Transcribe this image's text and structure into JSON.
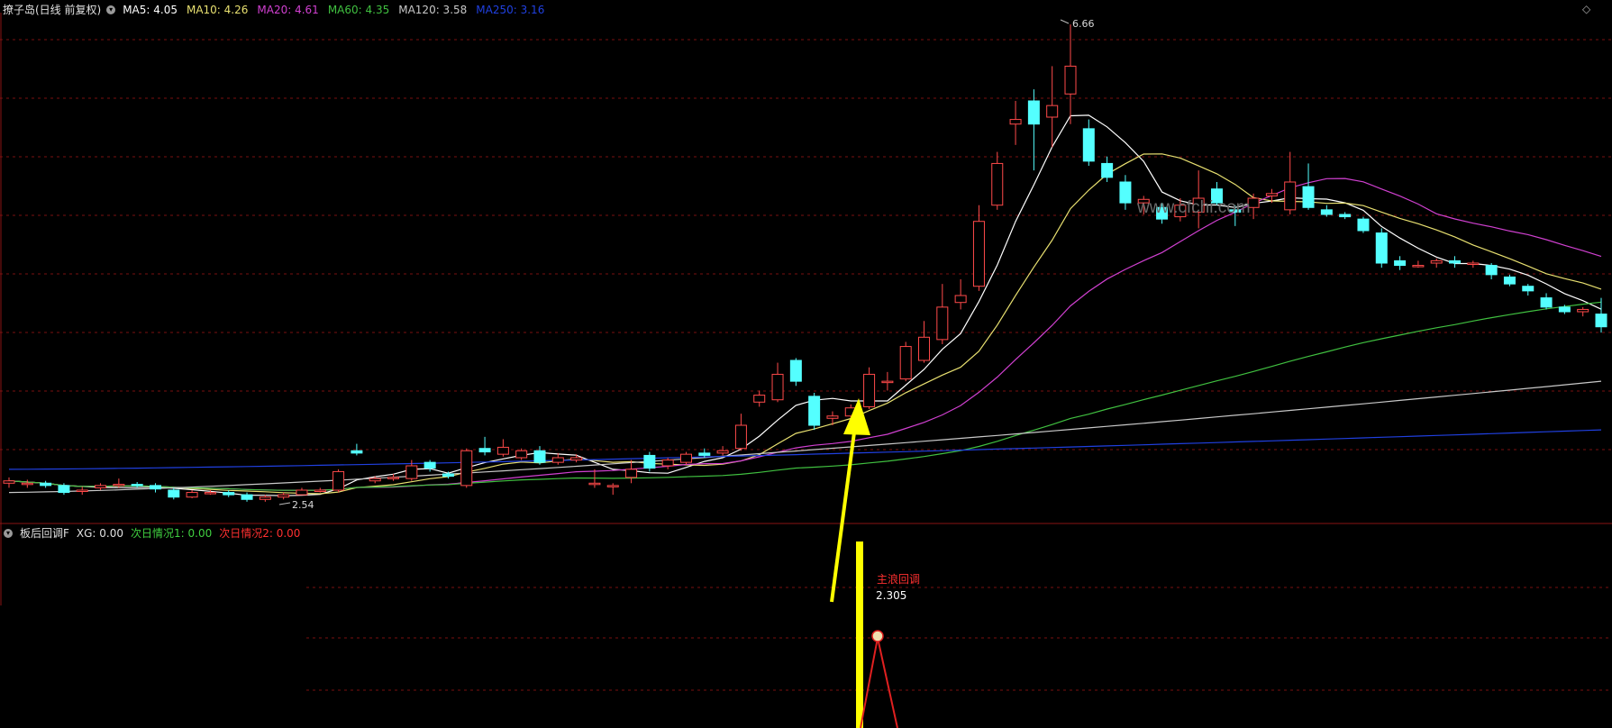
{
  "main_header": {
    "title": "撩子岛(日线 前复权)",
    "mas": [
      {
        "label": "MA5: 4.05",
        "color": "#ffffff"
      },
      {
        "label": "MA10: 4.26",
        "color": "#e8e070"
      },
      {
        "label": "MA20: 4.61",
        "color": "#d040d0"
      },
      {
        "label": "MA60: 4.35",
        "color": "#40c040"
      },
      {
        "label": "MA120: 3.58",
        "color": "#c8c8c8"
      },
      {
        "label": "MA250: 3.16",
        "color": "#2040e0"
      }
    ]
  },
  "main_annotations": {
    "high": "6.66",
    "low": "2.54"
  },
  "watermark": "www.cfchi.com",
  "sub_header": {
    "name": "板后回调F",
    "xg": "XG: 0.00",
    "c1": "次日情况1: 0.00",
    "c2": "次日情况2: 0.00"
  },
  "sub_annotations": {
    "label": "主浪回调",
    "value": "2.305"
  },
  "corner_icons": {
    "left": "◇",
    "right": "◇"
  },
  "colors": {
    "up": "#ff4a4a",
    "down": "#54ffff",
    "grid": "#7a1010",
    "arrow": "#ffff00"
  },
  "chart_data": {
    "type": "candlestick",
    "period": "daily",
    "adjusted": "forward-adjusted",
    "price_range": [
      2.5,
      6.7
    ],
    "candles": [
      [
        2.7,
        2.72,
        2.66,
        2.75
      ],
      [
        2.7,
        2.7,
        2.66,
        2.73
      ],
      [
        2.7,
        2.68,
        2.66,
        2.72
      ],
      [
        2.68,
        2.62,
        2.6,
        2.7
      ],
      [
        2.64,
        2.64,
        2.6,
        2.67
      ],
      [
        2.66,
        2.68,
        2.64,
        2.7
      ],
      [
        2.68,
        2.69,
        2.66,
        2.74
      ],
      [
        2.69,
        2.68,
        2.66,
        2.71
      ],
      [
        2.68,
        2.65,
        2.62,
        2.7
      ],
      [
        2.64,
        2.58,
        2.56,
        2.66
      ],
      [
        2.58,
        2.62,
        2.57,
        2.64
      ],
      [
        2.62,
        2.62,
        2.6,
        2.64
      ],
      [
        2.62,
        2.6,
        2.58,
        2.64
      ],
      [
        2.6,
        2.56,
        2.54,
        2.62
      ],
      [
        2.56,
        2.58,
        2.54,
        2.6
      ],
      [
        2.58,
        2.6,
        2.56,
        2.62
      ],
      [
        2.6,
        2.64,
        2.6,
        2.66
      ],
      [
        2.64,
        2.64,
        2.62,
        2.66
      ],
      [
        2.64,
        2.8,
        2.62,
        2.82
      ],
      [
        2.98,
        2.96,
        2.94,
        3.04
      ],
      [
        2.72,
        2.74,
        2.7,
        2.76
      ],
      [
        2.75,
        2.75,
        2.72,
        2.78
      ],
      [
        2.74,
        2.85,
        2.72,
        2.9
      ],
      [
        2.88,
        2.83,
        2.8,
        2.9
      ],
      [
        2.78,
        2.76,
        2.74,
        2.8
      ],
      [
        2.68,
        2.98,
        2.66,
        3.0
      ],
      [
        3.0,
        2.97,
        2.94,
        3.1
      ],
      [
        2.95,
        3.01,
        2.93,
        3.08
      ],
      [
        2.92,
        2.98,
        2.9,
        3.0
      ],
      [
        2.98,
        2.88,
        2.86,
        3.02
      ],
      [
        2.88,
        2.92,
        2.86,
        2.96
      ],
      [
        2.9,
        2.92,
        2.88,
        2.95
      ],
      [
        2.7,
        2.7,
        2.66,
        2.82
      ],
      [
        2.68,
        2.68,
        2.6,
        2.7
      ],
      [
        2.75,
        2.82,
        2.7,
        2.9
      ],
      [
        2.94,
        2.83,
        2.8,
        2.97
      ],
      [
        2.85,
        2.9,
        2.82,
        2.92
      ],
      [
        2.88,
        2.95,
        2.86,
        2.97
      ],
      [
        2.96,
        2.94,
        2.92,
        3.0
      ],
      [
        2.96,
        2.98,
        2.94,
        3.02
      ],
      [
        3.0,
        3.2,
        2.98,
        3.3
      ],
      [
        3.4,
        3.46,
        3.36,
        3.5
      ],
      [
        3.42,
        3.64,
        3.4,
        3.74
      ],
      [
        3.76,
        3.58,
        3.54,
        3.78
      ],
      [
        3.45,
        3.2,
        3.16,
        3.48
      ],
      [
        3.26,
        3.28,
        3.2,
        3.32
      ],
      [
        3.28,
        3.35,
        3.26,
        3.38
      ],
      [
        3.36,
        3.64,
        3.34,
        3.7
      ],
      [
        3.58,
        3.58,
        3.5,
        3.66
      ],
      [
        3.6,
        3.88,
        3.58,
        3.92
      ],
      [
        3.76,
        3.96,
        3.74,
        4.1
      ],
      [
        3.94,
        4.22,
        3.9,
        4.42
      ],
      [
        4.26,
        4.32,
        4.2,
        4.46
      ],
      [
        4.4,
        4.96,
        4.36,
        5.1
      ],
      [
        5.1,
        5.46,
        5.06,
        5.56
      ],
      [
        5.8,
        5.84,
        5.62,
        6.0
      ],
      [
        6.0,
        5.8,
        5.4,
        6.1
      ],
      [
        5.86,
        5.96,
        5.6,
        6.3
      ],
      [
        6.06,
        6.3,
        5.8,
        6.66
      ],
      [
        5.76,
        5.48,
        5.44,
        5.84
      ],
      [
        5.46,
        5.34,
        5.3,
        5.52
      ],
      [
        5.3,
        5.12,
        5.06,
        5.36
      ],
      [
        5.12,
        5.15,
        5.02,
        5.18
      ],
      [
        5.08,
        4.98,
        4.94,
        5.12
      ],
      [
        5.0,
        5.1,
        4.96,
        5.16
      ],
      [
        5.04,
        5.16,
        4.9,
        5.4
      ],
      [
        5.24,
        5.12,
        5.1,
        5.3
      ],
      [
        5.06,
        5.04,
        4.92,
        5.1
      ],
      [
        5.08,
        5.16,
        4.98,
        5.2
      ],
      [
        5.18,
        5.2,
        5.12,
        5.24
      ],
      [
        5.06,
        5.3,
        5.02,
        5.56
      ],
      [
        5.26,
        5.08,
        5.06,
        5.46
      ],
      [
        5.06,
        5.02,
        5.0,
        5.1
      ],
      [
        5.02,
        5.0,
        4.98,
        5.04
      ],
      [
        4.98,
        4.88,
        4.86,
        5.0
      ],
      [
        4.86,
        4.6,
        4.56,
        4.9
      ],
      [
        4.62,
        4.58,
        4.54,
        4.66
      ],
      [
        4.58,
        4.58,
        4.56,
        4.62
      ],
      [
        4.6,
        4.62,
        4.56,
        4.64
      ],
      [
        4.62,
        4.6,
        4.56,
        4.66
      ],
      [
        4.6,
        4.6,
        4.56,
        4.62
      ],
      [
        4.58,
        4.5,
        4.46,
        4.6
      ],
      [
        4.48,
        4.42,
        4.4,
        4.5
      ],
      [
        4.4,
        4.36,
        4.32,
        4.42
      ],
      [
        4.3,
        4.22,
        4.2,
        4.34
      ],
      [
        4.22,
        4.18,
        4.16,
        4.24
      ],
      [
        4.18,
        4.2,
        4.14,
        4.22
      ],
      [
        4.16,
        4.05,
        4.0,
        4.3
      ]
    ],
    "ma_values": {
      "MA5": 4.05,
      "MA10": 4.26,
      "MA20": 4.61,
      "MA60": 4.35,
      "MA120": 3.58,
      "MA250": 3.16
    },
    "indicator": {
      "name": "板后回调F",
      "XG": 0.0,
      "次日情况1": 0.0,
      "次日情况2": 0.0,
      "signal_value": 2.305,
      "signal_label": "主浪回调"
    }
  }
}
